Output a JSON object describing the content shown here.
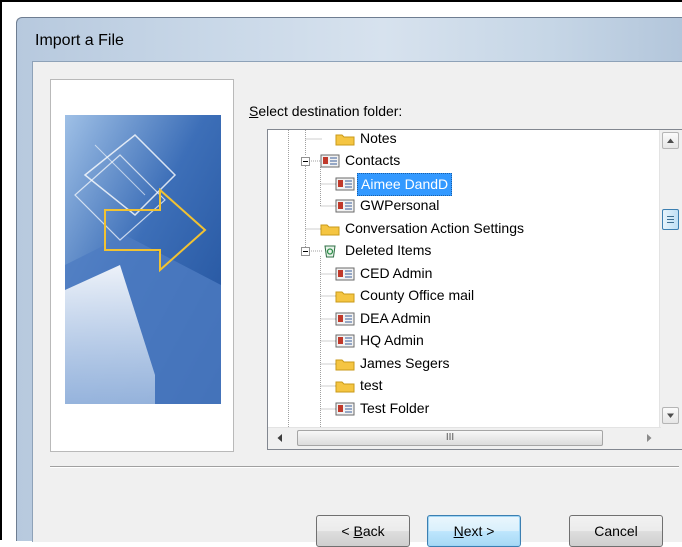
{
  "window": {
    "title": "Import a File"
  },
  "prompt": {
    "label": "Select destination folder:",
    "mnemonic": "S",
    "rest": "elect destination folder:"
  },
  "tree": {
    "items": [
      {
        "label": "Notes",
        "icon": "folder-icon",
        "selected": false
      },
      {
        "label": "Contacts",
        "icon": "contacts-folder-icon",
        "selected": false
      },
      {
        "label": "Aimee DandD",
        "icon": "contacts-folder-icon",
        "selected": true
      },
      {
        "label": "GWPersonal",
        "icon": "contacts-folder-icon",
        "selected": false
      },
      {
        "label": "Conversation Action Settings",
        "icon": "folder-icon",
        "selected": false
      },
      {
        "label": "Deleted Items",
        "icon": "recycle-bin-icon",
        "selected": false
      },
      {
        "label": "CED Admin",
        "icon": "contacts-folder-icon",
        "selected": false
      },
      {
        "label": "County Office mail",
        "icon": "folder-icon",
        "selected": false
      },
      {
        "label": "DEA Admin",
        "icon": "contacts-folder-icon",
        "selected": false
      },
      {
        "label": "HQ Admin",
        "icon": "contacts-folder-icon",
        "selected": false
      },
      {
        "label": "James Segers",
        "icon": "folder-icon",
        "selected": false
      },
      {
        "label": "test",
        "icon": "folder-icon",
        "selected": false
      },
      {
        "label": "Test Folder",
        "icon": "contacts-folder-icon",
        "selected": false
      }
    ]
  },
  "scrollbars": {
    "hscroll_grip": "III"
  },
  "buttons": {
    "back": {
      "prefix": "< ",
      "mnemonic": "B",
      "rest": "ack"
    },
    "next": {
      "mnemonic": "N",
      "rest": "ext >"
    },
    "cancel": {
      "label": "Cancel"
    }
  },
  "colors": {
    "selection": "#3399ff",
    "folder": "#f5c542",
    "contacts_card": "#c0392b"
  }
}
